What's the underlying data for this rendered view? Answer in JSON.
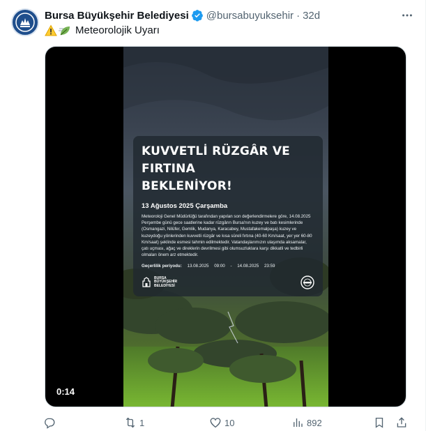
{
  "author": {
    "name": "Bursa Büyükşehir Belediyesi",
    "handle": "@bursabuyuksehir",
    "separator": "·",
    "time": "32d",
    "verified_icon": "verified-badge-icon"
  },
  "tweet": {
    "emojis": [
      "warning-emoji",
      "leaf-wind-emoji"
    ],
    "text": "Meteorolojik Uyarı"
  },
  "media": {
    "duration": "0:14",
    "poster": {
      "title_line1": "KUVVETLİ RÜZGÂR VE FIRTINA",
      "title_line2": "BEKLENİYOR!",
      "date": "13 Ağustos 2025 Çarşamba",
      "body": "Meteoroloji Genel Müdürlüğü tarafından yapılan son değerlendirmelere göre, 14.08.2025 Perşembe günü gece saatlerine kadar rüzgârın Bursa'nın kuzey ve batı kesimlerinde (Osmangazi, Nilüfer, Gemlik, Mudanya, Karacabey, Mustafakemalpaşa) kuzey ve kuzeydoğu yönlerinden kuvvetli rüzgâr ve kısa süreli fırtına (40-60 Km/saat, yer yer 60-80 Km/saat) şeklinde esmesi tahmin edilmektedir. Vatandaşlarımızın ulaşımda aksamalar, çatı uçması, ağaç ve direklerin devrilmesi gibi olumsuzluklara karşı dikkatli ve tedbirli olmaları önem arz etmektedir.",
      "validity_label": "Geçerlilik periyodu:",
      "validity_start_date": "13.08.2025",
      "validity_start_time": "09:00",
      "validity_dash": "-",
      "validity_end_date": "14.08.2025",
      "validity_end_time": "23:59",
      "logo_text_1": "BURSA",
      "logo_text_2": "BÜYÜKŞEHİR",
      "logo_text_3": "BELEDİYESİ"
    }
  },
  "actions": {
    "reply": {
      "icon": "reply-icon",
      "count": ""
    },
    "retweet": {
      "icon": "retweet-icon",
      "count": "1"
    },
    "like": {
      "icon": "heart-icon",
      "count": "10"
    },
    "views": {
      "icon": "views-icon",
      "count": "892"
    },
    "bookmark": {
      "icon": "bookmark-icon"
    },
    "share": {
      "icon": "share-icon"
    }
  },
  "colors": {
    "verified": "#1d9bf0",
    "secondary_text": "#536471",
    "primary_text": "#0f1419"
  }
}
